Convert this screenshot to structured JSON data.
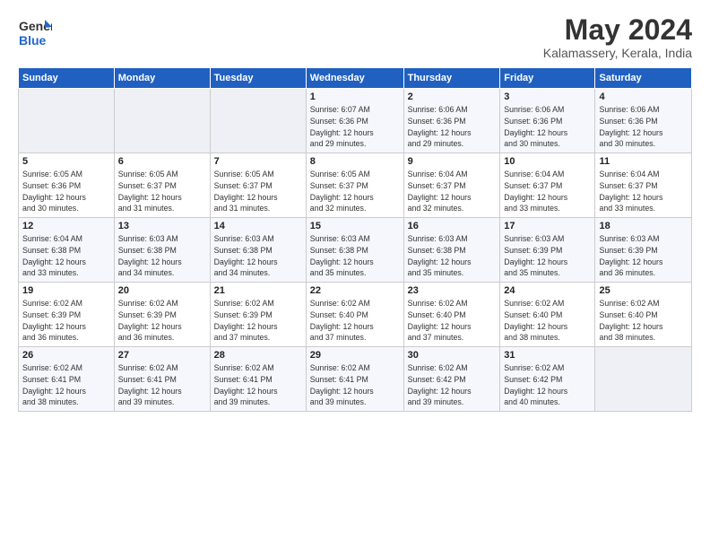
{
  "header": {
    "logo_line1": "General",
    "logo_line2": "Blue",
    "month": "May 2024",
    "location": "Kalamassery, Kerala, India"
  },
  "days_of_week": [
    "Sunday",
    "Monday",
    "Tuesday",
    "Wednesday",
    "Thursday",
    "Friday",
    "Saturday"
  ],
  "weeks": [
    [
      {
        "num": "",
        "info": ""
      },
      {
        "num": "",
        "info": ""
      },
      {
        "num": "",
        "info": ""
      },
      {
        "num": "1",
        "info": "Sunrise: 6:07 AM\nSunset: 6:36 PM\nDaylight: 12 hours\nand 29 minutes."
      },
      {
        "num": "2",
        "info": "Sunrise: 6:06 AM\nSunset: 6:36 PM\nDaylight: 12 hours\nand 29 minutes."
      },
      {
        "num": "3",
        "info": "Sunrise: 6:06 AM\nSunset: 6:36 PM\nDaylight: 12 hours\nand 30 minutes."
      },
      {
        "num": "4",
        "info": "Sunrise: 6:06 AM\nSunset: 6:36 PM\nDaylight: 12 hours\nand 30 minutes."
      }
    ],
    [
      {
        "num": "5",
        "info": "Sunrise: 6:05 AM\nSunset: 6:36 PM\nDaylight: 12 hours\nand 30 minutes."
      },
      {
        "num": "6",
        "info": "Sunrise: 6:05 AM\nSunset: 6:37 PM\nDaylight: 12 hours\nand 31 minutes."
      },
      {
        "num": "7",
        "info": "Sunrise: 6:05 AM\nSunset: 6:37 PM\nDaylight: 12 hours\nand 31 minutes."
      },
      {
        "num": "8",
        "info": "Sunrise: 6:05 AM\nSunset: 6:37 PM\nDaylight: 12 hours\nand 32 minutes."
      },
      {
        "num": "9",
        "info": "Sunrise: 6:04 AM\nSunset: 6:37 PM\nDaylight: 12 hours\nand 32 minutes."
      },
      {
        "num": "10",
        "info": "Sunrise: 6:04 AM\nSunset: 6:37 PM\nDaylight: 12 hours\nand 33 minutes."
      },
      {
        "num": "11",
        "info": "Sunrise: 6:04 AM\nSunset: 6:37 PM\nDaylight: 12 hours\nand 33 minutes."
      }
    ],
    [
      {
        "num": "12",
        "info": "Sunrise: 6:04 AM\nSunset: 6:38 PM\nDaylight: 12 hours\nand 33 minutes."
      },
      {
        "num": "13",
        "info": "Sunrise: 6:03 AM\nSunset: 6:38 PM\nDaylight: 12 hours\nand 34 minutes."
      },
      {
        "num": "14",
        "info": "Sunrise: 6:03 AM\nSunset: 6:38 PM\nDaylight: 12 hours\nand 34 minutes."
      },
      {
        "num": "15",
        "info": "Sunrise: 6:03 AM\nSunset: 6:38 PM\nDaylight: 12 hours\nand 35 minutes."
      },
      {
        "num": "16",
        "info": "Sunrise: 6:03 AM\nSunset: 6:38 PM\nDaylight: 12 hours\nand 35 minutes."
      },
      {
        "num": "17",
        "info": "Sunrise: 6:03 AM\nSunset: 6:39 PM\nDaylight: 12 hours\nand 35 minutes."
      },
      {
        "num": "18",
        "info": "Sunrise: 6:03 AM\nSunset: 6:39 PM\nDaylight: 12 hours\nand 36 minutes."
      }
    ],
    [
      {
        "num": "19",
        "info": "Sunrise: 6:02 AM\nSunset: 6:39 PM\nDaylight: 12 hours\nand 36 minutes."
      },
      {
        "num": "20",
        "info": "Sunrise: 6:02 AM\nSunset: 6:39 PM\nDaylight: 12 hours\nand 36 minutes."
      },
      {
        "num": "21",
        "info": "Sunrise: 6:02 AM\nSunset: 6:39 PM\nDaylight: 12 hours\nand 37 minutes."
      },
      {
        "num": "22",
        "info": "Sunrise: 6:02 AM\nSunset: 6:40 PM\nDaylight: 12 hours\nand 37 minutes."
      },
      {
        "num": "23",
        "info": "Sunrise: 6:02 AM\nSunset: 6:40 PM\nDaylight: 12 hours\nand 37 minutes."
      },
      {
        "num": "24",
        "info": "Sunrise: 6:02 AM\nSunset: 6:40 PM\nDaylight: 12 hours\nand 38 minutes."
      },
      {
        "num": "25",
        "info": "Sunrise: 6:02 AM\nSunset: 6:40 PM\nDaylight: 12 hours\nand 38 minutes."
      }
    ],
    [
      {
        "num": "26",
        "info": "Sunrise: 6:02 AM\nSunset: 6:41 PM\nDaylight: 12 hours\nand 38 minutes."
      },
      {
        "num": "27",
        "info": "Sunrise: 6:02 AM\nSunset: 6:41 PM\nDaylight: 12 hours\nand 39 minutes."
      },
      {
        "num": "28",
        "info": "Sunrise: 6:02 AM\nSunset: 6:41 PM\nDaylight: 12 hours\nand 39 minutes."
      },
      {
        "num": "29",
        "info": "Sunrise: 6:02 AM\nSunset: 6:41 PM\nDaylight: 12 hours\nand 39 minutes."
      },
      {
        "num": "30",
        "info": "Sunrise: 6:02 AM\nSunset: 6:42 PM\nDaylight: 12 hours\nand 39 minutes."
      },
      {
        "num": "31",
        "info": "Sunrise: 6:02 AM\nSunset: 6:42 PM\nDaylight: 12 hours\nand 40 minutes."
      },
      {
        "num": "",
        "info": ""
      }
    ]
  ]
}
